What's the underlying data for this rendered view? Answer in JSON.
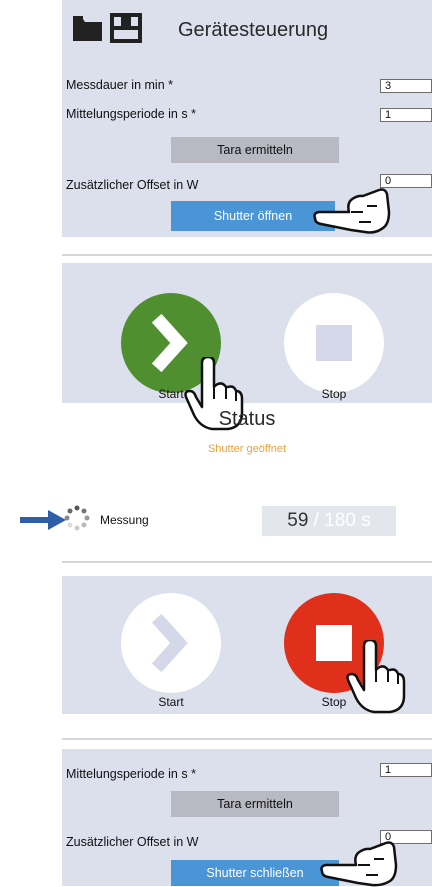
{
  "panel1": {
    "title": "Gerätesteuerung",
    "rows": [
      {
        "label": "Messdauer in min *",
        "value": "3"
      },
      {
        "label": "Mittelungsperiode in s *",
        "value": "1"
      }
    ],
    "tara_label": "Tara ermitteln",
    "offset_label": "Zusätzlicher Offset in W",
    "offset_value": "0",
    "shutter_label": "Shutter öffnen"
  },
  "panel2": {
    "start_label": "Start",
    "stop_label": "Stop",
    "status_title": "Status",
    "status_text": "Shutter geöffnet",
    "progress_label": "Messung",
    "progress_current": "59",
    "progress_total": " / 180 s"
  },
  "panel3": {
    "start_label": "Start",
    "stop_label": "Stop"
  },
  "panel4": {
    "row_label": "Mittelungsperiode in s *",
    "row_value": "1",
    "tara_label": "Tara ermitteln",
    "offset_label": "Zusätzlicher Offset in W",
    "offset_value": "0",
    "shutter_label": "Shutter schließen"
  },
  "colors": {
    "panel_bg": "#dcdfec",
    "button_blue": "#4a95d6",
    "start_green": "#4f8f2f",
    "stop_red": "#e0301b",
    "status_orange": "#e8a33d",
    "arrow_blue": "#2e5ea8"
  },
  "icons": [
    "folder-icon",
    "save-icon",
    "pointing-hand-icon",
    "play-chevron-icon",
    "stop-square-icon",
    "spinner-icon",
    "arrow-right-icon"
  ]
}
